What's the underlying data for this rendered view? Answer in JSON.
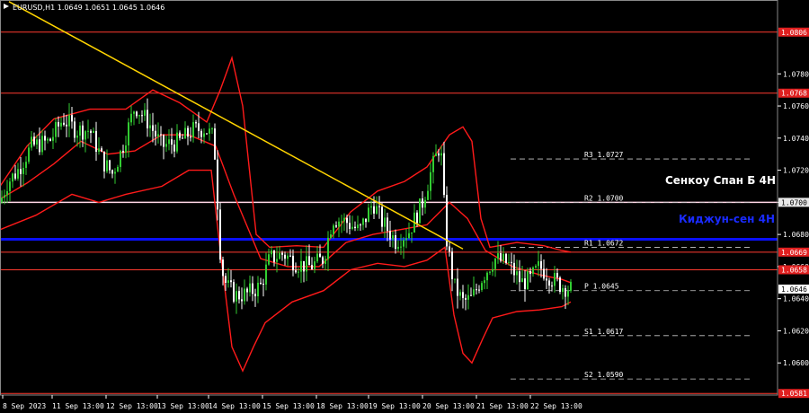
{
  "window": {
    "symbol_line": "EURUSD,H1  1.0649 1.0651 1.0645 1.0646"
  },
  "colors": {
    "background": "#000000",
    "bull_candle": "#32cd32",
    "bear_candle": "#ffffff",
    "bollinger": "#ff1a1a",
    "trendline": "#ffd400",
    "kijun": "#0a10ff",
    "senkou": "#ffd6e6",
    "level_red": "#ff3b30",
    "level_badge": "#e02020",
    "pivot_text": "#ffffff",
    "axis": "#ffffff"
  },
  "chart_data": {
    "type": "candlestick",
    "title": "EURUSD,H1  1.0649 1.0651 1.0645 1.0646",
    "ylim": [
      1.058,
      1.0826
    ],
    "y_ticks": [
      "1.0780",
      "1.0760",
      "1.0740",
      "1.0720",
      "1.0700",
      "1.0680",
      "1.0660",
      "1.0640",
      "1.0620",
      "1.0600"
    ],
    "x_ticks": [
      "8 Sep 2023",
      "11 Sep 13:00",
      "12 Sep 13:00",
      "13 Sep 13:00",
      "14 Sep 13:00",
      "15 Sep 13:00",
      "18 Sep 13:00",
      "19 Sep 13:00",
      "20 Sep 13:00",
      "21 Sep 13:00",
      "22 Sep 13:00"
    ],
    "price_path": [
      [
        0,
        1.07
      ],
      [
        8,
        1.0712
      ],
      [
        20,
        1.072
      ],
      [
        35,
        1.0735
      ],
      [
        55,
        1.0738
      ],
      [
        70,
        1.0752
      ],
      [
        85,
        1.0745
      ],
      [
        100,
        1.0745
      ],
      [
        115,
        1.0725
      ],
      [
        125,
        1.0718
      ],
      [
        135,
        1.0732
      ],
      [
        150,
        1.076
      ],
      [
        165,
        1.075
      ],
      [
        180,
        1.0735
      ],
      [
        200,
        1.0738
      ],
      [
        215,
        1.0745
      ],
      [
        228,
        1.0746
      ],
      [
        238,
        1.074
      ],
      [
        242,
        1.07
      ],
      [
        246,
        1.066
      ],
      [
        252,
        1.0648
      ],
      [
        262,
        1.0642
      ],
      [
        275,
        1.0643
      ],
      [
        290,
        1.0648
      ],
      [
        300,
        1.0665
      ],
      [
        315,
        1.0668
      ],
      [
        330,
        1.0662
      ],
      [
        345,
        1.066
      ],
      [
        360,
        1.0665
      ],
      [
        370,
        1.069
      ],
      [
        385,
        1.0688
      ],
      [
        400,
        1.0682
      ],
      [
        415,
        1.07
      ],
      [
        425,
        1.0688
      ],
      [
        440,
        1.0676
      ],
      [
        455,
        1.0682
      ],
      [
        470,
        1.07
      ],
      [
        480,
        1.072
      ],
      [
        490,
        1.0737
      ],
      [
        496,
        1.068
      ],
      [
        505,
        1.0648
      ],
      [
        515,
        1.0638
      ],
      [
        525,
        1.064
      ],
      [
        535,
        1.0652
      ],
      [
        550,
        1.0665
      ],
      [
        565,
        1.0662
      ],
      [
        580,
        1.065
      ],
      [
        590,
        1.0652
      ],
      [
        600,
        1.066
      ],
      [
        615,
        1.0652
      ],
      [
        625,
        1.0648
      ],
      [
        635,
        1.0646
      ]
    ],
    "bollinger_upper": [
      [
        0,
        1.071
      ],
      [
        30,
        1.0735
      ],
      [
        60,
        1.0752
      ],
      [
        100,
        1.0758
      ],
      [
        140,
        1.0758
      ],
      [
        170,
        1.077
      ],
      [
        200,
        1.0762
      ],
      [
        230,
        1.075
      ],
      [
        245,
        1.077
      ],
      [
        258,
        1.079
      ],
      [
        270,
        1.076
      ],
      [
        285,
        1.068
      ],
      [
        300,
        1.0672
      ],
      [
        330,
        1.0673
      ],
      [
        360,
        1.0672
      ],
      [
        390,
        1.0694
      ],
      [
        420,
        1.0707
      ],
      [
        450,
        1.0713
      ],
      [
        475,
        1.0722
      ],
      [
        500,
        1.0742
      ],
      [
        515,
        1.0747
      ],
      [
        525,
        1.0738
      ],
      [
        535,
        1.069
      ],
      [
        545,
        1.0672
      ],
      [
        575,
        1.0675
      ],
      [
        605,
        1.0673
      ],
      [
        625,
        1.067
      ],
      [
        635,
        1.0669
      ]
    ],
    "bollinger_middle": [
      [
        0,
        1.0702
      ],
      [
        30,
        1.0712
      ],
      [
        60,
        1.0724
      ],
      [
        90,
        1.0738
      ],
      [
        120,
        1.073
      ],
      [
        150,
        1.0732
      ],
      [
        180,
        1.0742
      ],
      [
        210,
        1.0742
      ],
      [
        240,
        1.0735
      ],
      [
        260,
        1.0705
      ],
      [
        290,
        1.0665
      ],
      [
        320,
        1.066
      ],
      [
        355,
        1.066
      ],
      [
        385,
        1.0675
      ],
      [
        415,
        1.068
      ],
      [
        445,
        1.0683
      ],
      [
        475,
        1.0686
      ],
      [
        500,
        1.07
      ],
      [
        520,
        1.069
      ],
      [
        540,
        1.067
      ],
      [
        570,
        1.066
      ],
      [
        600,
        1.0655
      ],
      [
        625,
        1.0652
      ],
      [
        635,
        1.065
      ]
    ],
    "bollinger_lower": [
      [
        0,
        1.0683
      ],
      [
        40,
        1.0692
      ],
      [
        80,
        1.0705
      ],
      [
        110,
        1.07
      ],
      [
        140,
        1.0705
      ],
      [
        180,
        1.071
      ],
      [
        210,
        1.072
      ],
      [
        235,
        1.072
      ],
      [
        245,
        1.067
      ],
      [
        258,
        1.061
      ],
      [
        270,
        1.0595
      ],
      [
        282,
        1.061
      ],
      [
        295,
        1.0625
      ],
      [
        325,
        1.0638
      ],
      [
        360,
        1.0645
      ],
      [
        390,
        1.0658
      ],
      [
        420,
        1.0662
      ],
      [
        450,
        1.066
      ],
      [
        475,
        1.0664
      ],
      [
        495,
        1.0672
      ],
      [
        505,
        1.063
      ],
      [
        515,
        1.0606
      ],
      [
        525,
        1.06
      ],
      [
        537,
        1.0615
      ],
      [
        548,
        1.0628
      ],
      [
        575,
        1.0632
      ],
      [
        600,
        1.0633
      ],
      [
        625,
        1.0635
      ],
      [
        635,
        1.0638
      ]
    ],
    "trendline": {
      "from": [
        10,
        1.0825
      ],
      "to": [
        515,
        1.0671
      ]
    },
    "horizontal_levels": [
      {
        "label": "1.0806",
        "value": 1.0806,
        "color": "#ff3b30",
        "badge": true
      },
      {
        "label": "1.0768",
        "value": 1.0768,
        "color": "#ff3b30",
        "badge": true
      },
      {
        "label": "1.0700",
        "value": 1.07,
        "color": "#ffd6e6",
        "badge": true
      },
      {
        "label": "1.0669",
        "value": 1.0669,
        "color": "#ff3b30",
        "badge": true
      },
      {
        "label": "1.0658",
        "value": 1.0658,
        "color": "#ff3b30",
        "badge": true
      },
      {
        "label": "1.0581",
        "value": 1.0581,
        "color": "#ff3b30",
        "badge": true
      },
      {
        "label": "1.0677",
        "value": 1.0677,
        "color": "#0a10ff",
        "badge": false
      }
    ],
    "pivots": [
      {
        "label": "R3 1.0727",
        "value": 1.0727
      },
      {
        "label": "R2 1.0700",
        "value": 1.07
      },
      {
        "label": "R1 1.0672",
        "value": 1.0672
      },
      {
        "label": "P  1.0645",
        "value": 1.0645
      },
      {
        "label": "S1 1.0617",
        "value": 1.0617
      },
      {
        "label": "S2 1.0590",
        "value": 1.059
      }
    ],
    "current_price": {
      "label": "1.0646",
      "value": 1.0646
    },
    "annotations": {
      "senkou": "Сенкоу Спан Б 4H",
      "kijun": "Киджун-сен 4H"
    }
  }
}
